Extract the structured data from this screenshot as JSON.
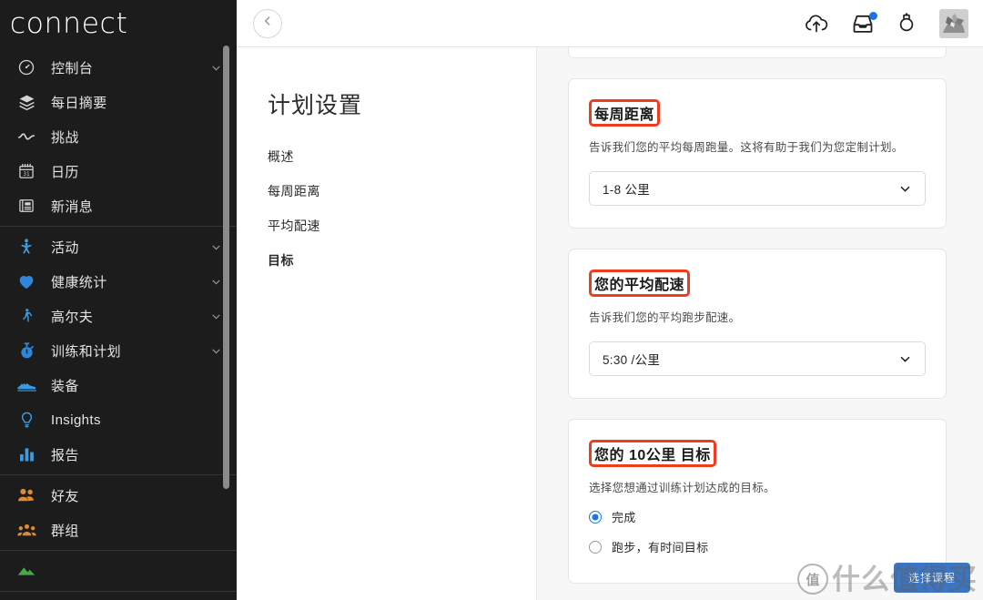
{
  "app": {
    "logo": "connect"
  },
  "sidebar": {
    "groups": [
      {
        "items": [
          {
            "label": "控制台",
            "icon": "dashboard-icon",
            "color": "#d4d4d4",
            "chevron": true
          },
          {
            "label": "每日摘要",
            "icon": "layers-icon",
            "color": "#d4d4d4",
            "chevron": false
          },
          {
            "label": "挑战",
            "icon": "wave-icon",
            "color": "#d4d4d4",
            "chevron": false
          },
          {
            "label": "日历",
            "icon": "calendar-icon",
            "color": "#d4d4d4",
            "chevron": false
          },
          {
            "label": "新消息",
            "icon": "news-icon",
            "color": "#d4d4d4",
            "chevron": false
          }
        ]
      },
      {
        "items": [
          {
            "label": "活动",
            "icon": "running-person-icon",
            "color": "#3d9ce0",
            "chevron": true
          },
          {
            "label": "健康统计",
            "icon": "heart-icon",
            "color": "#2f86d8",
            "chevron": true
          },
          {
            "label": "高尔夫",
            "icon": "golf-icon",
            "color": "#3d9ce0",
            "chevron": true
          },
          {
            "label": "训练和计划",
            "icon": "stopwatch-icon",
            "color": "#2f86d8",
            "chevron": true
          },
          {
            "label": "装备",
            "icon": "shoe-icon",
            "color": "#3d9ce0",
            "chevron": false
          },
          {
            "label": "Insights",
            "icon": "lightbulb-icon",
            "color": "#3d9ce0",
            "chevron": false
          },
          {
            "label": "报告",
            "icon": "bar-chart-icon",
            "color": "#3d9ce0",
            "chevron": false
          }
        ]
      },
      {
        "items": [
          {
            "label": "好友",
            "icon": "friends-icon",
            "color": "#e08a33",
            "chevron": false
          },
          {
            "label": "群组",
            "icon": "groups-icon",
            "color": "#e08a33",
            "chevron": false
          }
        ]
      },
      {
        "items": [
          {
            "label": "",
            "icon": "mountain-icon",
            "color": "#4aa84a",
            "chevron": false
          }
        ]
      }
    ]
  },
  "topbar": {
    "back_icon": "chevron-left-icon",
    "icons": [
      {
        "name": "cloud-upload-icon",
        "badge": false
      },
      {
        "name": "inbox-icon",
        "badge": true
      },
      {
        "name": "watch-icon",
        "badge": false
      }
    ],
    "avatar": "user-avatar"
  },
  "leftpane": {
    "title": "计划设置",
    "links": [
      {
        "label": "概述",
        "active": false
      },
      {
        "label": "每周距离",
        "active": false
      },
      {
        "label": "平均配速",
        "active": false
      },
      {
        "label": "目标",
        "active": true
      }
    ]
  },
  "cards": {
    "weekly_distance": {
      "title": "每周距离",
      "description": "告诉我们您的平均每周跑量。这将有助于我们为您定制计划。",
      "select_value": "1-8 公里",
      "chevron_icon": "chevron-down-icon"
    },
    "average_pace": {
      "title": "您的平均配速",
      "description": "告诉我们您的平均跑步配速。",
      "select_value": "5:30 /公里",
      "chevron_icon": "chevron-down-icon"
    },
    "goal": {
      "title": "您的 10公里 目标",
      "description": "选择您想通过训练计划达成的目标。",
      "options": [
        {
          "label": "完成",
          "selected": true
        },
        {
          "label": "跑步，有时间目标",
          "selected": false
        }
      ]
    }
  },
  "overlay": {
    "button_label": "选择课程",
    "watermark_logo": "值",
    "watermark_text": "什么值得买"
  },
  "colors": {
    "sidebar_bg": "#1c1c1c",
    "accent_blue": "#1b74e4",
    "annotation_red": "#f03c1e",
    "content_bg": "#f7f7f7",
    "orange": "#e08a33"
  }
}
